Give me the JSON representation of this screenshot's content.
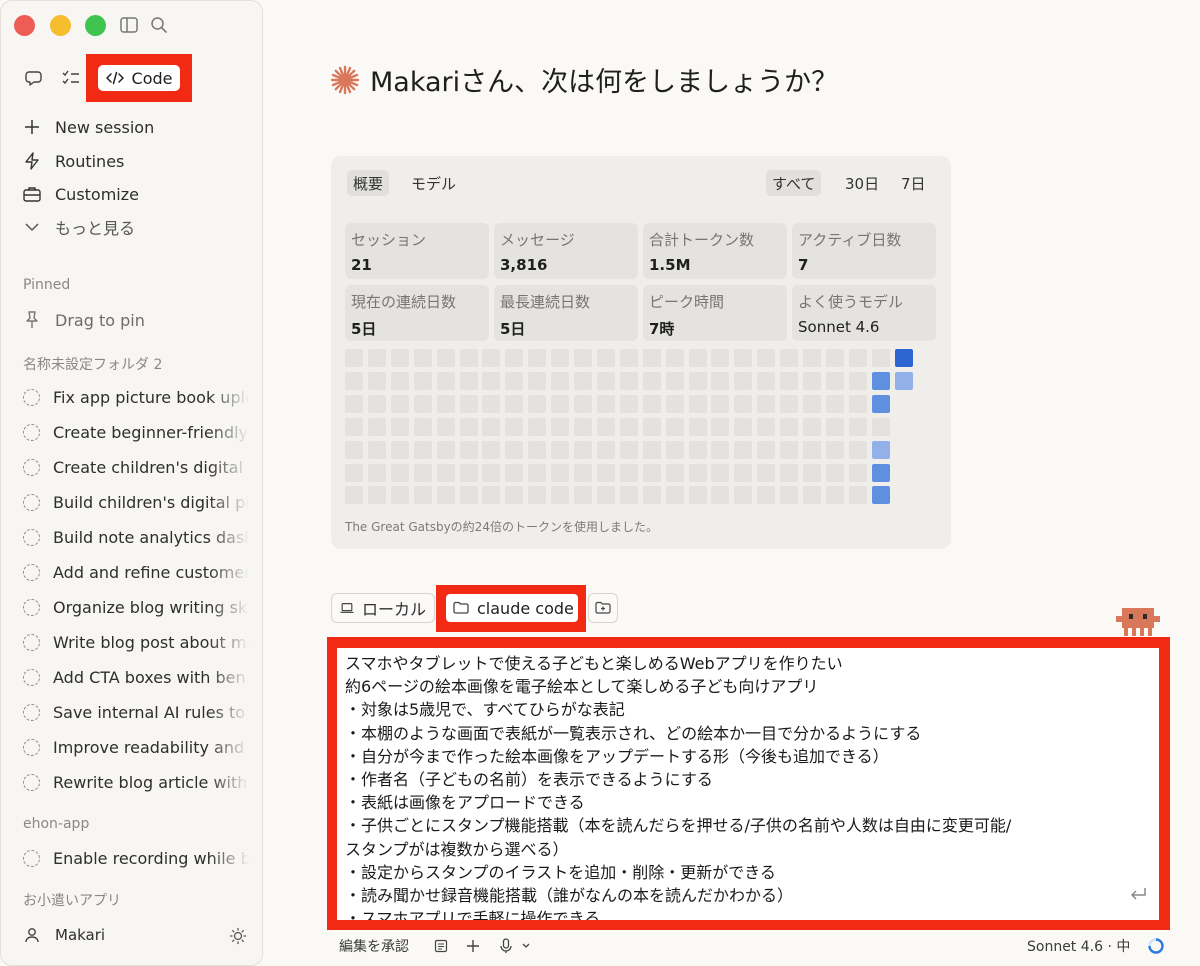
{
  "sidebar": {
    "code_label": "Code",
    "nav": [
      {
        "label": "New session",
        "icon": "plus-icon"
      },
      {
        "label": "Routines",
        "icon": "bolt-icon"
      },
      {
        "label": "Customize",
        "icon": "briefcase-icon"
      },
      {
        "label": "もっと見る",
        "icon": "chevron-down-icon"
      }
    ],
    "pinned_label": "Pinned",
    "drag_to_pin": "Drag to pin",
    "folder_label": "名称未設定フォルダ 2",
    "sessions": [
      "Fix app picture book uplo",
      "Create beginner-friendly",
      "Create children's digital p",
      "Build children's digital pi",
      "Build note analytics dash",
      "Add and refine customer",
      "Organize blog writing ski",
      "Write blog post about me",
      "Add CTA boxes with ben",
      "Save internal AI rules to G",
      "Improve readability and c",
      "Rewrite blog article with"
    ],
    "ehon_label": "ehon-app",
    "ehon_sessions": [
      "Enable recording while b"
    ],
    "okozukai_label": "お小遣いアプリ",
    "user_name": "Makari"
  },
  "main": {
    "heading": "Makariさん、次は何をしましょうか？",
    "accent": "#d9775a"
  },
  "stats": {
    "tabs_left": [
      "概要",
      "モデル"
    ],
    "tabs_right": [
      "すべて",
      "30日",
      "7日"
    ],
    "boxes": [
      {
        "label": "セッション",
        "value": "21"
      },
      {
        "label": "メッセージ",
        "value": "3,816"
      },
      {
        "label": "合計トークン数",
        "value": "1.5M"
      },
      {
        "label": "アクティブ日数",
        "value": "7"
      },
      {
        "label": "現在の連続日数",
        "value": "5日"
      },
      {
        "label": "最長連続日数",
        "value": "5日"
      },
      {
        "label": "ピーク時間",
        "value": "7時"
      },
      {
        "label": "よく使うモデル",
        "value": "Sonnet 4.6"
      }
    ],
    "heatmap_cols": 25,
    "heatmap_rows": 7,
    "active_cells": [
      {
        "col": 24,
        "row": 0,
        "level": 3
      },
      {
        "col": 23,
        "row": 1,
        "level": 2
      },
      {
        "col": 24,
        "row": 1,
        "level": 1
      },
      {
        "col": 23,
        "row": 2,
        "level": 2
      },
      {
        "col": 23,
        "row": 4,
        "level": 1
      },
      {
        "col": 23,
        "row": 5,
        "level": 2
      },
      {
        "col": 23,
        "row": 6,
        "level": 2
      }
    ],
    "level_colors": [
      "#e3e2de",
      "#93b1e8",
      "#5f8fe0",
      "#2e66d1"
    ],
    "footnote": "The Great Gatsbyの約24倍のトークンを使用しました。"
  },
  "toolbar": {
    "local_label": "ローカル",
    "folder_label": "claude code"
  },
  "prompt": {
    "lines": [
      "スマホやタブレットで使える子どもと楽しめるWebアプリを作りたい",
      "約6ページの絵本画像を電子絵本として楽しめる子ども向けアプリ",
      "・対象は5歳児で、すべてひらがな表記",
      "・本棚のような画面で表紙が一覧表示され、どの絵本か一目で分かるようにする",
      "・自分が今まで作った絵本画像をアップデートする形（今後も追加できる）",
      "・作者名（子どもの名前）を表示できるようにする",
      "・表紙は画像をアプロードできる",
      "・子供ごとにスタンプ機能搭載（本を読んだらを押せる/子供の名前や人数は自由に変更可能/",
      "スタンプがは複数から選べる）",
      "・設定からスタンプのイラストを追加・削除・更新ができる",
      "・読み聞かせ録音機能搭載（誰がなんの本を読んだかわかる）",
      "・スマホアプリで手軽に操作できる"
    ]
  },
  "bottom": {
    "accept_edits": "編集を承認",
    "model_label": "Sonnet 4.6 · 中"
  },
  "highlight_color": "#f22a14"
}
